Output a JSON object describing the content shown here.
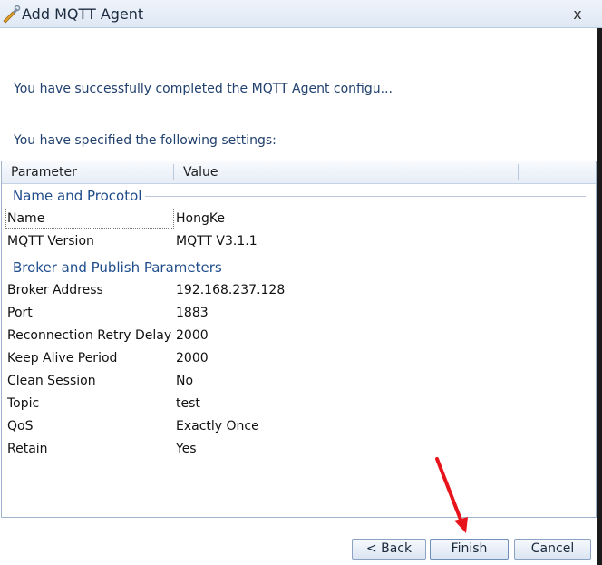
{
  "window": {
    "title": "Add MQTT Agent",
    "close_label": "x",
    "icon": "wrench-pencil-icon"
  },
  "messages": {
    "completed": "You have successfully completed the MQTT Agent configu...",
    "specified": "You have specified the following settings:"
  },
  "grid": {
    "columns": [
      "Parameter",
      "Value"
    ],
    "groups": [
      {
        "title": "Name and Procotol",
        "rows": [
          {
            "param": "Name",
            "value": "HongKe"
          },
          {
            "param": "MQTT Version",
            "value": "MQTT V3.1.1"
          }
        ]
      },
      {
        "title": "Broker and Publish Parameters",
        "rows": [
          {
            "param": "Broker Address",
            "value": "192.168.237.128"
          },
          {
            "param": "Port",
            "value": "1883"
          },
          {
            "param": "Reconnection Retry Delay",
            "value": "2000"
          },
          {
            "param": "Keep Alive Period",
            "value": "2000"
          },
          {
            "param": "Clean Session",
            "value": "No"
          },
          {
            "param": "Topic",
            "value": "test"
          },
          {
            "param": "QoS",
            "value": "Exactly Once"
          },
          {
            "param": "Retain",
            "value": "Yes"
          }
        ]
      }
    ]
  },
  "buttons": {
    "back": "< Back",
    "finish": "Finish",
    "cancel": "Cancel"
  },
  "annotation": {
    "arrow_color": "#e8141b"
  }
}
